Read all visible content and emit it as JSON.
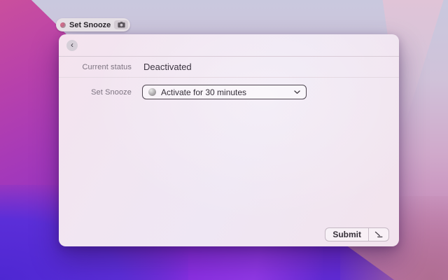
{
  "wallpaper": {
    "style": "macos-monterey-gradient",
    "colors": {
      "magenta": "#ca4f9d",
      "purple": "#8c30c8",
      "indigo": "#5529d4",
      "violet": "#8a2fe2",
      "lavender": "#c9c8de",
      "pink": "#cfa0c6",
      "rose": "#b06e92"
    }
  },
  "tag": {
    "label": "Set Snooze"
  },
  "panel": {
    "back_glyph": "‹",
    "rows": {
      "status": {
        "label": "Current status",
        "value": "Deactivated"
      },
      "snooze": {
        "label": "Set Snooze",
        "dropdown": {
          "selected": "Activate for 30 minutes"
        }
      }
    },
    "footer": {
      "submit": "Submit"
    }
  }
}
